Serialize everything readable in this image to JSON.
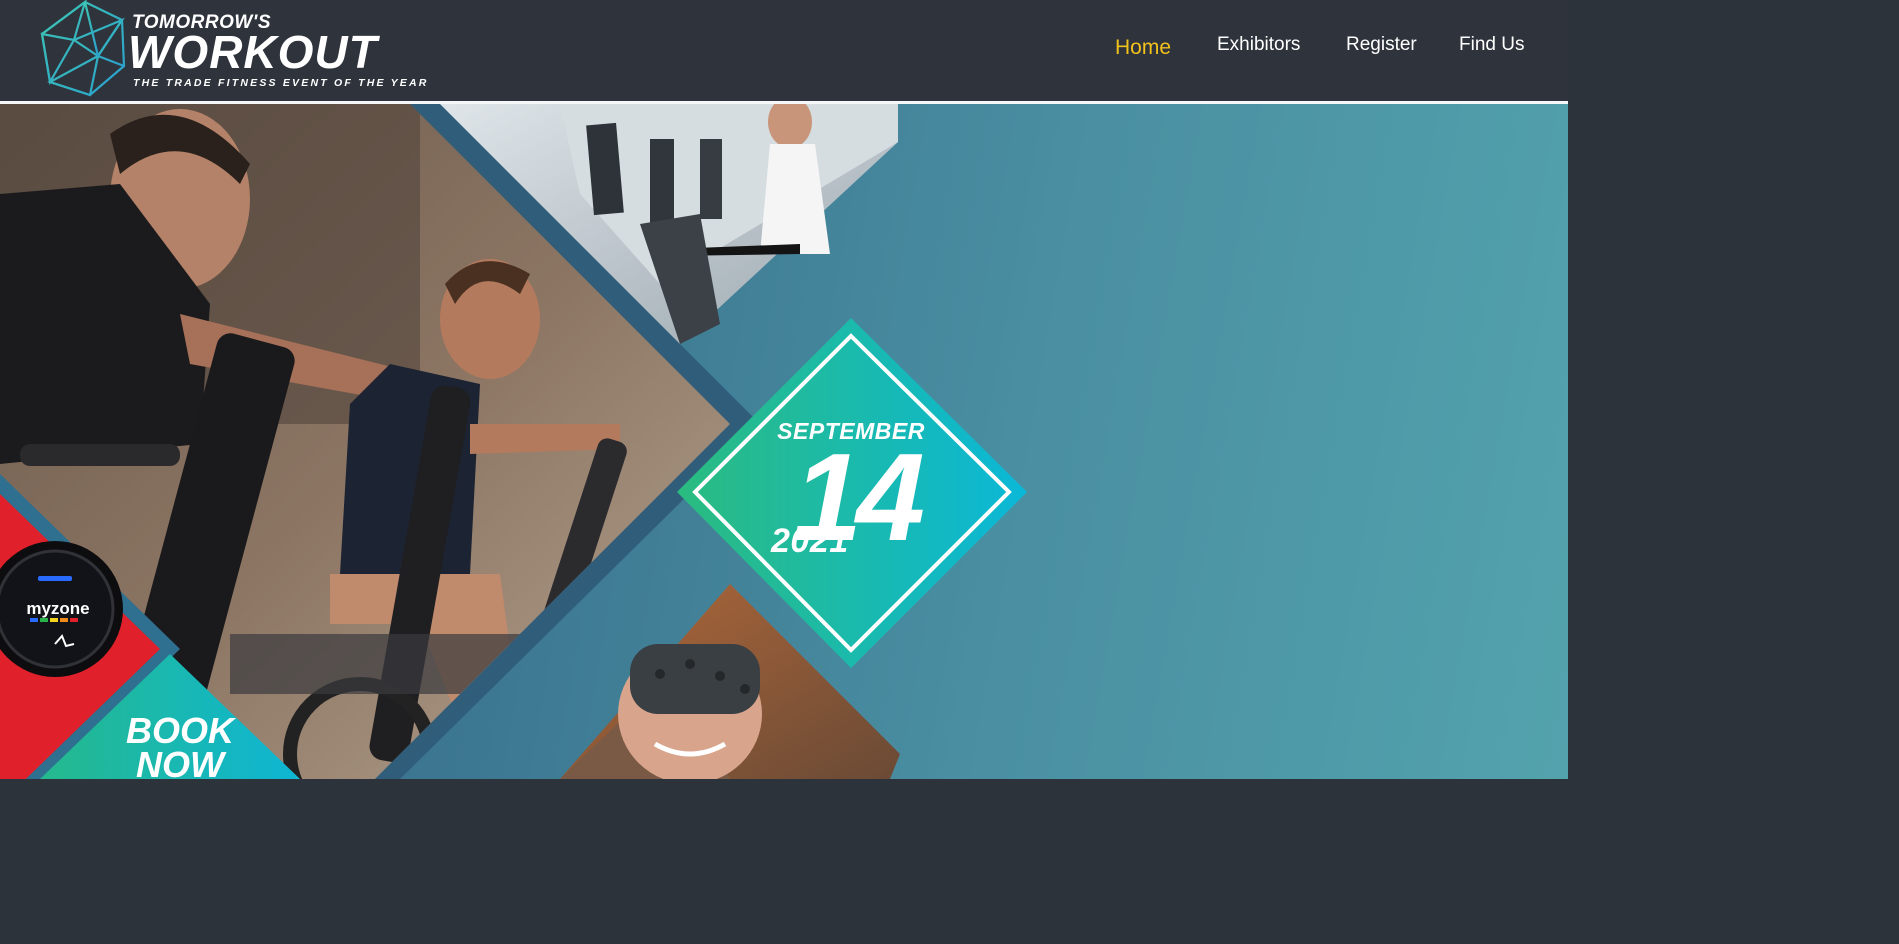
{
  "brand": {
    "top_line": "TOMORROW'S",
    "name": "WORKOUT",
    "tagline": "THE TRADE FITNESS EVENT OF THE YEAR"
  },
  "nav": {
    "items": [
      {
        "label": "Home",
        "active": true
      },
      {
        "label": "Exhibitors",
        "active": false
      },
      {
        "label": "Register",
        "active": false
      },
      {
        "label": "Find Us",
        "active": false
      }
    ]
  },
  "hero": {
    "date": {
      "month": "SEPTEMBER",
      "day": "14",
      "year": "2021"
    },
    "cta": {
      "line1": "BOOK",
      "line2": "NOW"
    },
    "watch_brand": "myzone"
  },
  "colors": {
    "header_bg": "#2e333c",
    "nav_active": "#f2c21a",
    "teal": "#1fb7a6",
    "cyan": "#0fb2d6",
    "watch_red": "#e0202a"
  }
}
